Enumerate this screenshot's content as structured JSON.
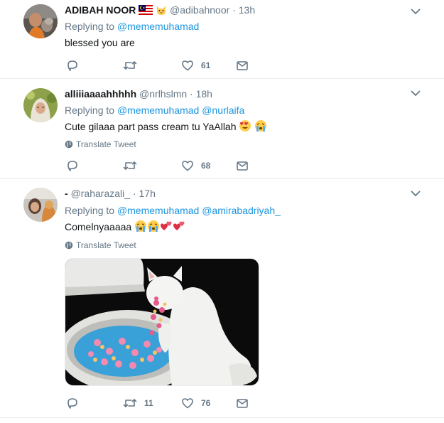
{
  "tweets": [
    {
      "name": "ADIBAH NOOR",
      "handle": "@adibahnoor",
      "dot": "·",
      "time": "13h",
      "replying_prefix": "Replying to",
      "mentions": [
        "@mememuhamad"
      ],
      "text": "blessed you are",
      "translate": "",
      "likes": "61",
      "retweets": ""
    },
    {
      "name": "alliiiaaaahhhhh",
      "handle": "@nrlhslmn",
      "dot": "·",
      "time": "18h",
      "replying_prefix": "Replying to",
      "mentions": [
        "@mememuhamad",
        "@nurlaifa"
      ],
      "text": "Cute gilaaa part pass cream tu YaAllah",
      "translate": "Translate Tweet",
      "likes": "68",
      "retweets": ""
    },
    {
      "name": "-",
      "handle": "@raharazali_",
      "dot": "·",
      "time": "17h",
      "replying_prefix": "Replying to",
      "mentions": [
        "@mememuhamad",
        "@amirabadriyah_"
      ],
      "text": "Comelnyaaaaa",
      "translate": "Translate Tweet",
      "likes": "76",
      "retweets": "11"
    }
  ],
  "icons": {
    "reply": "reply-icon",
    "retweet": "retweet-icon",
    "like": "heart-icon",
    "dm": "envelope-icon",
    "caret": "chevron-down-icon",
    "globe": "globe-icon"
  },
  "colors": {
    "link": "#1b95e0",
    "muted": "#657786",
    "border": "#e6ecf0"
  }
}
